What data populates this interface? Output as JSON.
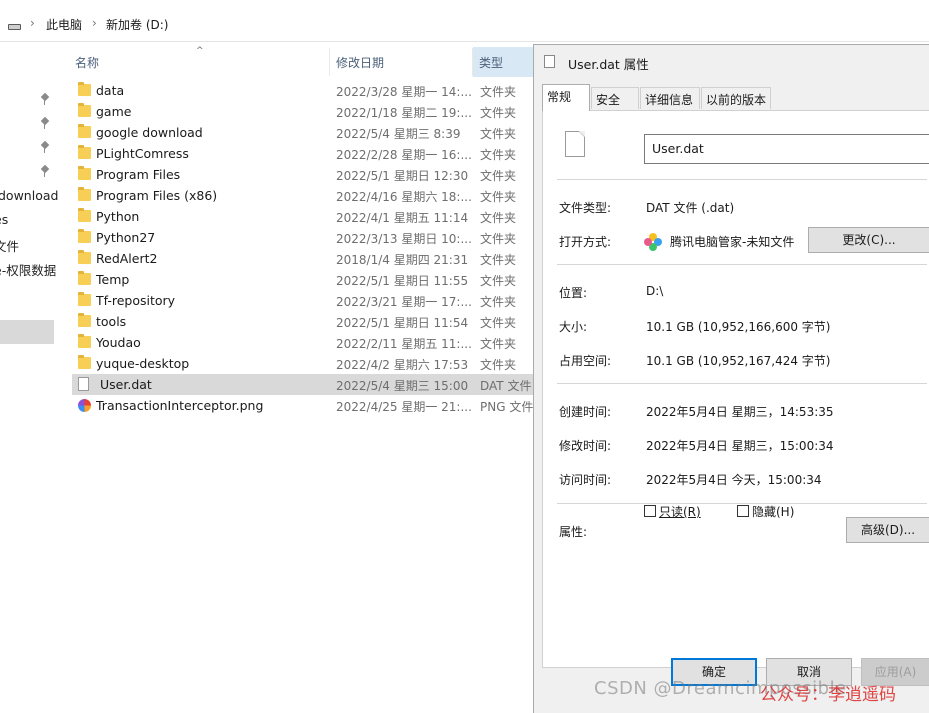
{
  "address": {
    "crumbs": [
      "此电脑",
      "新加卷 (D:)"
    ]
  },
  "nav": {
    "items": [
      "download",
      "es",
      "文件",
      "e-权限数据"
    ]
  },
  "columns": {
    "name": "名称",
    "date": "修改日期",
    "type": "类型"
  },
  "files": [
    {
      "name": "data",
      "date": "2022/3/28 星期一 14:...",
      "type": "文件夹",
      "icon": "folder-icon"
    },
    {
      "name": "game",
      "date": "2022/1/18 星期二 19:...",
      "type": "文件夹",
      "icon": "folder-icon"
    },
    {
      "name": "google download",
      "date": "2022/5/4 星期三 8:39",
      "type": "文件夹",
      "icon": "folder-icon"
    },
    {
      "name": "PLightComress",
      "date": "2022/2/28 星期一 16:...",
      "type": "文件夹",
      "icon": "folder-icon"
    },
    {
      "name": "Program Files",
      "date": "2022/5/1 星期日 12:30",
      "type": "文件夹",
      "icon": "folder-icon"
    },
    {
      "name": "Program Files (x86)",
      "date": "2022/4/16 星期六 18:...",
      "type": "文件夹",
      "icon": "folder-icon"
    },
    {
      "name": "Python",
      "date": "2022/4/1 星期五 11:14",
      "type": "文件夹",
      "icon": "folder-icon"
    },
    {
      "name": "Python27",
      "date": "2022/3/13 星期日 10:...",
      "type": "文件夹",
      "icon": "folder-icon"
    },
    {
      "name": "RedAlert2",
      "date": "2018/1/4 星期四 21:31",
      "type": "文件夹",
      "icon": "folder-icon"
    },
    {
      "name": "Temp",
      "date": "2022/5/1 星期日 11:55",
      "type": "文件夹",
      "icon": "folder-icon"
    },
    {
      "name": "Tf-repository",
      "date": "2022/3/21 星期一 17:...",
      "type": "文件夹",
      "icon": "folder-icon"
    },
    {
      "name": "tools",
      "date": "2022/5/1 星期日 11:54",
      "type": "文件夹",
      "icon": "folder-icon"
    },
    {
      "name": "Youdao",
      "date": "2022/2/11 星期五 11:...",
      "type": "文件夹",
      "icon": "folder-icon"
    },
    {
      "name": "yuque-desktop",
      "date": "2022/4/2 星期六 17:53",
      "type": "文件夹",
      "icon": "folder-icon"
    },
    {
      "name": "User.dat",
      "date": "2022/5/4 星期三 15:00",
      "type": "DAT 文件",
      "icon": "file-icon",
      "selected": true
    },
    {
      "name": "TransactionInterceptor.png",
      "date": "2022/4/25 星期一 21:...",
      "type": "PNG 文件",
      "icon": "png-icon"
    }
  ],
  "dialog": {
    "title": "User.dat 属性",
    "tabs": [
      "常规",
      "安全",
      "详细信息",
      "以前的版本"
    ],
    "filename": "User.dat",
    "file_type_label": "文件类型:",
    "file_type": "DAT 文件 (.dat)",
    "open_with_label": "打开方式:",
    "open_with": "腾讯电脑管家-未知文件",
    "change_button": "更改(C)...",
    "location_label": "位置:",
    "location": "D:\\",
    "size_label": "大小:",
    "size": "10.1 GB (10,952,166,600 字节)",
    "size_on_disk_label": "占用空间:",
    "size_on_disk": "10.1 GB (10,952,167,424 字节)",
    "created_label": "创建时间:",
    "created": "2022年5月4日 星期三，14:53:35",
    "modified_label": "修改时间:",
    "modified": "2022年5月4日 星期三，15:00:34",
    "accessed_label": "访问时间:",
    "accessed": "2022年5月4日 今天，15:00:34",
    "attributes_label": "属性:",
    "readonly_label": "只读(R)",
    "hidden_label": "隐藏(H)",
    "advanced_button": "高级(D)...",
    "ok_button": "确定",
    "cancel_button": "取消",
    "apply_button": "应用(A)"
  },
  "watermark": {
    "text": "CSDN @Dreamcimpossible",
    "overlay": "公众号：李逍遥码"
  },
  "colors": {
    "selection": "#d9d9d9",
    "folder": "#f7cf57",
    "default_button_border": "#0078d7"
  }
}
